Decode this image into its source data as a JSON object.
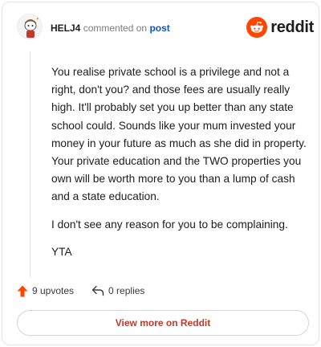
{
  "header": {
    "username": "HELJ4",
    "verb": "commented on",
    "target": "post",
    "brand": "reddit"
  },
  "comment": {
    "paragraphs": [
      "You realise private school is a privilege and not a right, don't you? and those fees are usually really high. It'll probably set you up better than any state school could. Sounds like your mum invested your money in your future as much as she did in property. Your private education and the TWO properties you own will be worth more to you than a lump of cash and a state education.",
      "I don't see any reason for you to be complaining.",
      "YTA"
    ]
  },
  "actions": {
    "upvotes": "9 upvotes",
    "replies": "0 replies"
  },
  "footer": {
    "view_more": "View more on Reddit"
  },
  "colors": {
    "brand": "#ff4500",
    "link": "#0a56c8",
    "view_more": "#c0392b"
  },
  "icons": [
    "avatar-snoo",
    "reddit-logo-icon",
    "upvote-arrow-icon",
    "reply-arrow-icon"
  ]
}
